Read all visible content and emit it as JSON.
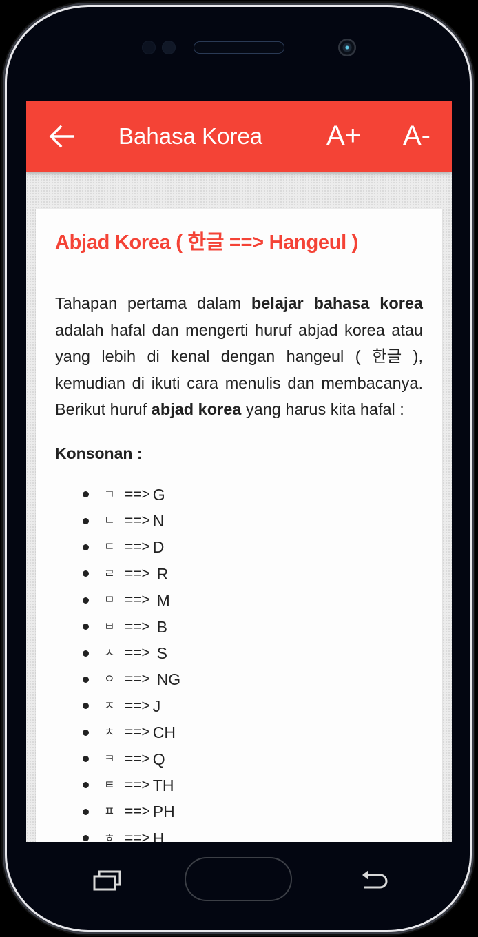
{
  "appbar": {
    "title": "Bahasa Korea",
    "back_icon": "arrow-left-icon",
    "font_increase_label": "A+",
    "font_decrease_label": "A-",
    "color": "#f44336"
  },
  "card": {
    "title": "Abjad Korea ( 한글 ==> Hangeul )",
    "intro": {
      "part1": "Tahapan pertama dalam ",
      "bold1": "belajar bahasa korea",
      "part2": " adalah hafal dan mengerti huruf abjad korea atau yang lebih di kenal dengan hangeul ( 한글 ), kemudian di ikuti cara menulis dan membacanya. Berikut huruf ",
      "bold2": "abjad korea",
      "part3": " yang harus kita hafal :"
    },
    "section_title": "Konsonan :",
    "konsonan": [
      {
        "jamo": "ㄱ",
        "arrow": "==>",
        "latin": "G"
      },
      {
        "jamo": "ㄴ",
        "arrow": "==>",
        "latin": "N"
      },
      {
        "jamo": "ㄷ",
        "arrow": "==>",
        "latin": "D"
      },
      {
        "jamo": "ㄹ",
        "arrow": "==> ",
        "latin": "R"
      },
      {
        "jamo": "ㅁ",
        "arrow": "==> ",
        "latin": "M"
      },
      {
        "jamo": "ㅂ",
        "arrow": "==> ",
        "latin": "B"
      },
      {
        "jamo": "ㅅ",
        "arrow": "==> ",
        "latin": "S"
      },
      {
        "jamo": "ㅇ",
        "arrow": "==> ",
        "latin": "NG"
      },
      {
        "jamo": "ㅈ",
        "arrow": "==>",
        "latin": "J"
      },
      {
        "jamo": "ㅊ",
        "arrow": "==>",
        "latin": "CH"
      },
      {
        "jamo": "ㅋ",
        "arrow": "==>",
        "latin": "Q"
      },
      {
        "jamo": "ㅌ",
        "arrow": "==>",
        "latin": "TH"
      },
      {
        "jamo": "ㅍ",
        "arrow": "==>",
        "latin": "PH"
      },
      {
        "jamo": "ㅎ",
        "arrow": "==>",
        "latin": "H"
      }
    ]
  },
  "navbar": {
    "recent_icon": "recent-apps-icon",
    "home_icon": "home-button",
    "back_icon": "back-nav-icon"
  }
}
